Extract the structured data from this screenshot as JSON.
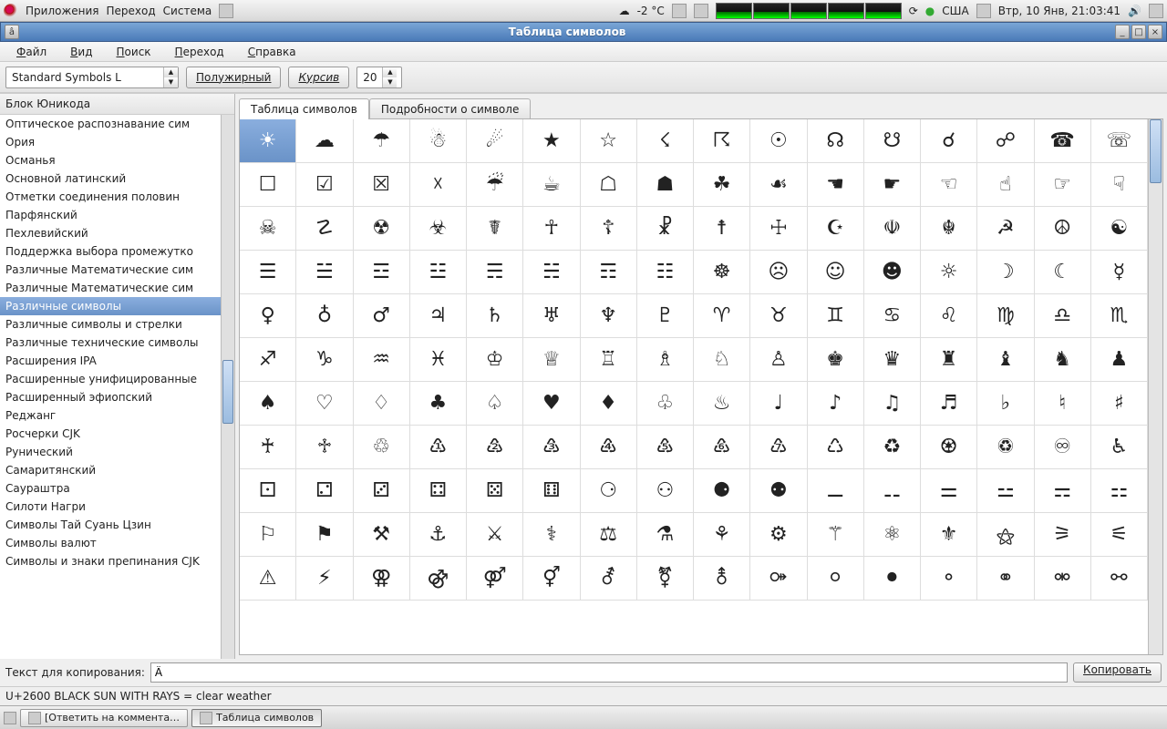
{
  "panel": {
    "menu": [
      "Приложения",
      "Переход",
      "Система"
    ],
    "weather": "-2 °C",
    "kbd": "США",
    "clock": "Втр, 10 Янв, 21:03:41"
  },
  "window": {
    "title": "Таблица символов",
    "minibtn": "â"
  },
  "menubar": [
    "Файл",
    "Вид",
    "Поиск",
    "Переход",
    "Справка"
  ],
  "toolbar": {
    "font": "Standard Symbols L",
    "bold": "Полужирный",
    "italic": "Курсив",
    "size": "20"
  },
  "sidebar": {
    "header": "Блок Юникода",
    "items": [
      "Оптическое распознавание сим",
      "Ория",
      "Османья",
      "Основной латинский",
      "Отметки соединения половин",
      "Парфянский",
      "Пехлевийский",
      "Поддержка выбора промежутко",
      "Различные Математические сим",
      "Различные Математические сим",
      "Различные символы",
      "Различные символы и стрелки",
      "Различные технические символы",
      "Расширения IPA",
      "Расширенные унифицированные",
      "Расширенный эфиопский",
      "Реджанг",
      "Росчерки CJK",
      "Рунический",
      "Самаритянский",
      "Саураштра",
      "Силоти Нагри",
      "Символы Тай Суань Цзин",
      "Символы валют",
      "Символы и знаки препинания CJK"
    ],
    "selected": 10
  },
  "tabs": {
    "items": [
      "Таблица символов",
      "Подробности о символе"
    ],
    "active": 0
  },
  "grid": {
    "selected": 0,
    "rows": [
      [
        "☀",
        "☁",
        "☂",
        "☃",
        "☄",
        "★",
        "☆",
        "☇",
        "☈",
        "☉",
        "☊",
        "☋",
        "☌",
        "☍",
        "☎",
        "☏"
      ],
      [
        "☐",
        "☑",
        "☒",
        "☓",
        "☔",
        "☕",
        "☖",
        "☗",
        "☘",
        "☙",
        "☚",
        "☛",
        "☜",
        "☝",
        "☞",
        "☟"
      ],
      [
        "☠",
        "☡",
        "☢",
        "☣",
        "☤",
        "☥",
        "☦",
        "☧",
        "☨",
        "☩",
        "☪",
        "☫",
        "☬",
        "☭",
        "☮",
        "☯"
      ],
      [
        "☰",
        "☱",
        "☲",
        "☳",
        "☴",
        "☵",
        "☶",
        "☷",
        "☸",
        "☹",
        "☺",
        "☻",
        "☼",
        "☽",
        "☾",
        "☿"
      ],
      [
        "♀",
        "♁",
        "♂",
        "♃",
        "♄",
        "♅",
        "♆",
        "♇",
        "♈",
        "♉",
        "♊",
        "♋",
        "♌",
        "♍",
        "♎",
        "♏"
      ],
      [
        "♐",
        "♑",
        "♒",
        "♓",
        "♔",
        "♕",
        "♖",
        "♗",
        "♘",
        "♙",
        "♚",
        "♛",
        "♜",
        "♝",
        "♞",
        "♟"
      ],
      [
        "♠",
        "♡",
        "♢",
        "♣",
        "♤",
        "♥",
        "♦",
        "♧",
        "♨",
        "♩",
        "♪",
        "♫",
        "♬",
        "♭",
        "♮",
        "♯"
      ],
      [
        "♰",
        "♱",
        "♲",
        "♳",
        "♴",
        "♵",
        "♶",
        "♷",
        "♸",
        "♹",
        "♺",
        "♻",
        "♼",
        "♽",
        "♾",
        "♿"
      ],
      [
        "⚀",
        "⚁",
        "⚂",
        "⚃",
        "⚄",
        "⚅",
        "⚆",
        "⚇",
        "⚈",
        "⚉",
        "⚊",
        "⚋",
        "⚌",
        "⚍",
        "⚎",
        "⚏"
      ],
      [
        "⚐",
        "⚑",
        "⚒",
        "⚓",
        "⚔",
        "⚕",
        "⚖",
        "⚗",
        "⚘",
        "⚙",
        "⚚",
        "⚛",
        "⚜",
        "⚝",
        "⚞",
        "⚟"
      ],
      [
        "⚠",
        "⚡",
        "⚢",
        "⚣",
        "⚤",
        "⚥",
        "⚦",
        "⚧",
        "⚨",
        "⚩",
        "⚪",
        "⚫",
        "⚬",
        "⚭",
        "⚮",
        "⚯"
      ]
    ]
  },
  "copyrow": {
    "label": "Текст для копирования:",
    "value": "Ä",
    "button": "Копировать"
  },
  "status": "U+2600 BLACK SUN WITH RAYS   = clear weather",
  "taskbar": {
    "items": [
      "[Ответить на коммента…",
      "Таблица символов"
    ],
    "active": 1
  }
}
